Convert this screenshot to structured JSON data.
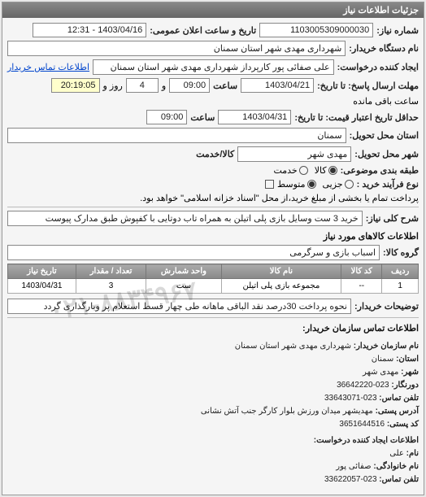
{
  "panel_title": "جزئیات اطلاعات نیاز",
  "fields": {
    "need_number_label": "شماره نیاز:",
    "need_number": "1103005309000030",
    "announce_date_label": "تاریخ و ساعت اعلان عمومی:",
    "announce_date": "1403/04/16 - 12:31",
    "buyer_device_label": "نام دستگاه خریدار:",
    "buyer_device": "شهرداری مهدی شهر استان سمنان",
    "requester_label": "ایجاد کننده درخواست:",
    "requester": "علی صفائی پور کارپرداز شهرداری مهدی شهر استان سمنان",
    "buyer_contact_link": "اطلاعات تماس خریدار",
    "deadline_reply_label": "مهلت ارسال پاسخ: تا تاریخ:",
    "deadline_reply_date": "1403/04/21",
    "time_label": "ساعت",
    "deadline_reply_time": "09:00",
    "day_and": "و",
    "days_remaining": "4",
    "days_remaining_suffix": "روز و",
    "time_remaining": "20:19:05",
    "time_remaining_suffix": "ساعت باقی مانده",
    "validity_label": "حداقل تاریخ اعتبار قیمت: تا تاریخ:",
    "validity_date": "1403/04/31",
    "validity_time": "09:00",
    "delivery_province_label": "استان محل تحویل:",
    "delivery_province": "سمنان",
    "delivery_city_label": "شهر محل تحویل:",
    "delivery_city": "مهدی شهر",
    "goods_service_label": "کالا/خدمت",
    "class_subject_label": "طبقه بندی موضوعی:",
    "purchase_type_label": "نوع فرآیند خرید :",
    "payment_note": "پرداخت تمام یا بخشی از مبلغ خرید،از محل \"اسناد خزانه اسلامی\" خواهد بود.",
    "need_desc_label": "شرح کلی نیاز:",
    "need_desc": "خرید 3 ست وسایل بازی پلی اتیلن به همراه تاب دوتایی با کفپوش طبق مدارک پیوست",
    "goods_info_title": "اطلاعات کالاهای مورد نیاز",
    "goods_group_label": "گروه کالا:",
    "goods_group": "اسباب بازی و سرگرمی",
    "buyer_note_label": "توضیحات خریدار:",
    "buyer_note": "نحوه پرداخت 30درصد نقد الباقی ماهانه طی چهار قسط استعلام پر وبارگذاری گردد"
  },
  "radios_class": [
    {
      "label": "کالا",
      "checked": true
    },
    {
      "label": "خدمت",
      "checked": false
    }
  ],
  "radios_purchase": [
    {
      "label": "جزیی",
      "checked": false
    },
    {
      "label": "متوسط",
      "checked": true
    }
  ],
  "table": {
    "headers": [
      "ردیف",
      "کد کالا",
      "نام کالا",
      "واحد شمارش",
      "تعداد / مقدار",
      "تاریخ نیاز"
    ],
    "rows": [
      {
        "idx": "1",
        "code": "--",
        "name": "مجموعه بازی پلی اتیلن",
        "unit": "ست",
        "qty": "3",
        "date": "1403/04/31"
      }
    ]
  },
  "contact_section_title": "اطلاعات تماس سازمان خریدار:",
  "contact": {
    "org_name_label": "نام سازمان خریدار:",
    "org_name": "شهرداری مهدی شهر استان سمنان",
    "province_label": "استان:",
    "province": "سمنان",
    "city_label": "شهر:",
    "city": "مهدی شهر",
    "fax_label": "دورنگار:",
    "fax": "023-36642220",
    "phone_label": "تلفن تماس:",
    "phone": "023-33643071",
    "address_label": "آدرس پستی:",
    "address": "مهدیشهر میدان ورزش بلوار کارگر جنب آتش نشانی",
    "postal_label": "کد پستی:",
    "postal": "3651644516",
    "requester_section_title": "اطلاعات ایجاد کننده درخواست:",
    "first_name_label": "نام:",
    "first_name": "علی",
    "last_name_label": "نام خانوادگی:",
    "last_name": "صفائی پور",
    "contact_phone_label": "تلفن تماس:",
    "contact_phone": "023-33622057"
  },
  "watermark": "۰۲۱-۸۸۳۴۹۶۷"
}
